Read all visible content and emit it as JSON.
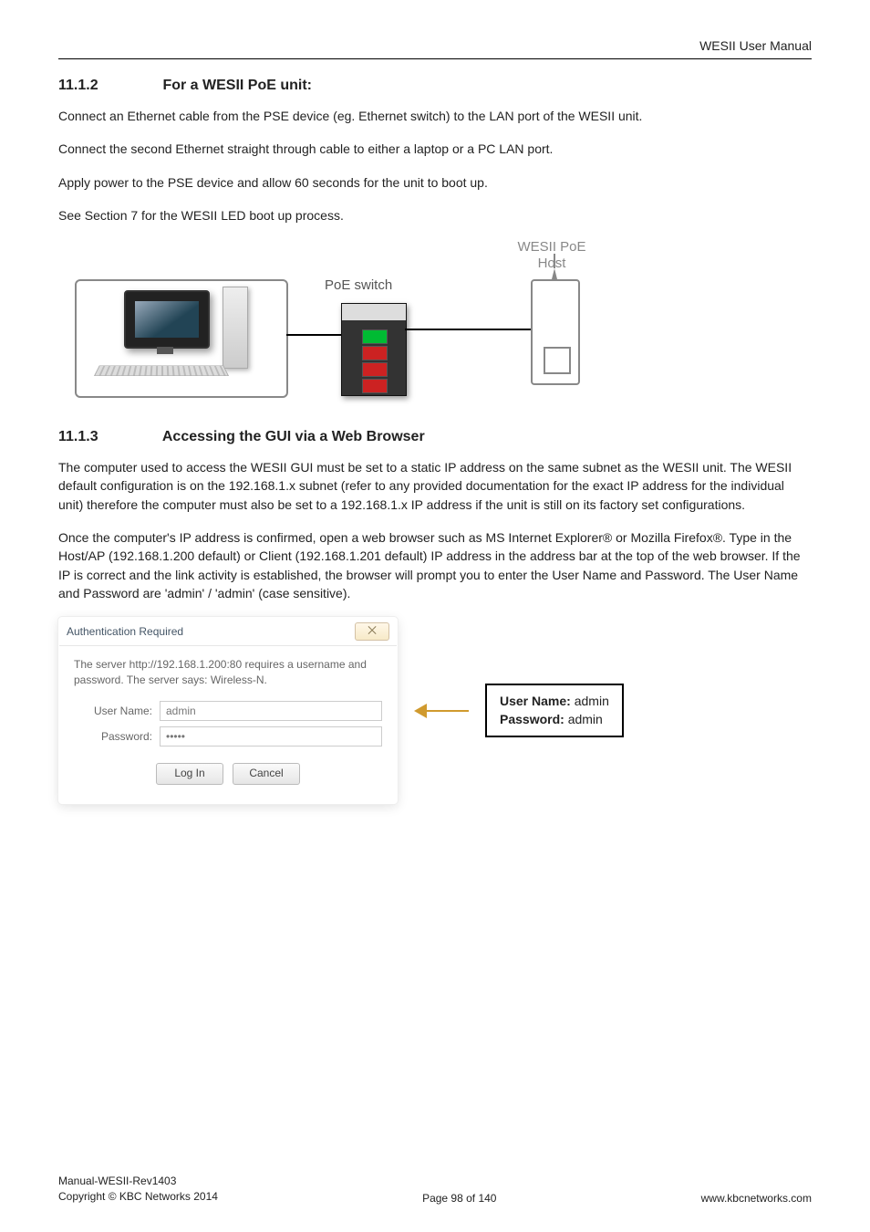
{
  "header": {
    "doc_title": "WESII User Manual"
  },
  "section1": {
    "num": "11.1.2",
    "title": "For a WESII PoE unit:",
    "p1": "Connect an Ethernet cable from the PSE device (eg. Ethernet switch) to the LAN port of the WESII unit.",
    "p2": "Connect the second Ethernet straight through cable to either a laptop or a PC LAN port.",
    "p3": "Apply power to the PSE device and allow 60 seconds for the unit to boot up.",
    "p4": "See Section 7 for the WESII LED boot up process."
  },
  "diagram": {
    "host_label_line1": "WESII PoE",
    "host_label_line2": "Host",
    "poe_label": "PoE switch"
  },
  "section2": {
    "num": "11.1.3",
    "title": "Accessing the GUI via a Web Browser",
    "p1": "The computer used to access the WESII GUI must be set to a static IP address on the same subnet as the WESII unit. The WESII default configuration is on the 192.168.1.x subnet (refer to any provided documentation for the exact IP address for the individual unit) therefore the computer must also be set to a 192.168.1.x IP address if the unit is still on its factory set configurations.",
    "p2": "Once the computer's IP address is confirmed, open a web browser such as MS Internet Explorer® or Mozilla Firefox®. Type in the Host/AP (192.168.1.200 default) or Client (192.168.1.201 default) IP address in the address bar at the top of the web browser. If the IP is correct and the link activity is established, the browser will prompt you to enter the User Name and Password. The User Name and Password are 'admin' / 'admin' (case sensitive)."
  },
  "dialog": {
    "title": "Authentication Required",
    "intro": "The server http://192.168.1.200:80 requires a username and password. The server says: Wireless-N.",
    "user_label": "User Name:",
    "user_value": "admin",
    "pass_label": "Password:",
    "pass_value": "•••••",
    "login": "Log In",
    "cancel": "Cancel",
    "close_glyph": "⨉"
  },
  "creds": {
    "user_label": "User Name:",
    "user_value": " admin",
    "pass_label": "Password:",
    "pass_value": " admin"
  },
  "footer": {
    "line1": "Manual-WESII-Rev1403",
    "line2": "Copyright © KBC Networks 2014",
    "center": "Page 98 of 140",
    "right": "www.kbcnetworks.com"
  }
}
